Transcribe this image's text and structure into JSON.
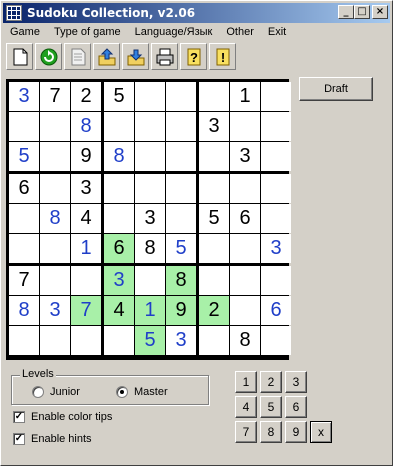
{
  "window": {
    "title": "Sudoku Collection, v2.06"
  },
  "menu": [
    "Game",
    "Type of game",
    "Language/Язык",
    "Other",
    "Exit"
  ],
  "toolbar": [
    "new-page-icon",
    "refresh-icon",
    "blank-document-icon",
    "upload-icon",
    "download-icon",
    "printer-icon",
    "question-mark-icon",
    "exclamation-icon"
  ],
  "draft_label": "Draft",
  "grid": [
    [
      {
        "v": "3",
        "k": "u"
      },
      {
        "v": "7",
        "k": "g"
      },
      {
        "v": "2",
        "k": "g"
      },
      {
        "v": "5",
        "k": "g"
      },
      {
        "v": "",
        "k": ""
      },
      {
        "v": "",
        "k": ""
      },
      {
        "v": "",
        "k": ""
      },
      {
        "v": "1",
        "k": "g"
      },
      {
        "v": "",
        "k": ""
      }
    ],
    [
      {
        "v": "",
        "k": ""
      },
      {
        "v": "",
        "k": ""
      },
      {
        "v": "8",
        "k": "u"
      },
      {
        "v": "",
        "k": ""
      },
      {
        "v": "",
        "k": ""
      },
      {
        "v": "",
        "k": ""
      },
      {
        "v": "3",
        "k": "g"
      },
      {
        "v": "",
        "k": ""
      },
      {
        "v": "",
        "k": ""
      }
    ],
    [
      {
        "v": "5",
        "k": "u"
      },
      {
        "v": "",
        "k": ""
      },
      {
        "v": "9",
        "k": "g"
      },
      {
        "v": "8",
        "k": "u"
      },
      {
        "v": "",
        "k": ""
      },
      {
        "v": "",
        "k": ""
      },
      {
        "v": "",
        "k": ""
      },
      {
        "v": "3",
        "k": "g"
      },
      {
        "v": "",
        "k": ""
      }
    ],
    [
      {
        "v": "6",
        "k": "g"
      },
      {
        "v": "",
        "k": ""
      },
      {
        "v": "3",
        "k": "g"
      },
      {
        "v": "",
        "k": ""
      },
      {
        "v": "",
        "k": ""
      },
      {
        "v": "",
        "k": ""
      },
      {
        "v": "",
        "k": ""
      },
      {
        "v": "",
        "k": ""
      },
      {
        "v": "",
        "k": ""
      }
    ],
    [
      {
        "v": "",
        "k": ""
      },
      {
        "v": "8",
        "k": "u"
      },
      {
        "v": "4",
        "k": "g"
      },
      {
        "v": "",
        "k": ""
      },
      {
        "v": "3",
        "k": "g"
      },
      {
        "v": "",
        "k": ""
      },
      {
        "v": "5",
        "k": "g"
      },
      {
        "v": "6",
        "k": "g"
      },
      {
        "v": "",
        "k": ""
      }
    ],
    [
      {
        "v": "",
        "k": ""
      },
      {
        "v": "",
        "k": ""
      },
      {
        "v": "1",
        "k": "u"
      },
      {
        "v": "6",
        "k": "g",
        "h": 1
      },
      {
        "v": "8",
        "k": "g"
      },
      {
        "v": "5",
        "k": "u"
      },
      {
        "v": "",
        "k": ""
      },
      {
        "v": "",
        "k": ""
      },
      {
        "v": "3",
        "k": "u"
      }
    ],
    [
      {
        "v": "7",
        "k": "g"
      },
      {
        "v": "",
        "k": ""
      },
      {
        "v": "",
        "k": ""
      },
      {
        "v": "3",
        "k": "u",
        "h": 1
      },
      {
        "v": "",
        "k": ""
      },
      {
        "v": "8",
        "k": "g",
        "h": 1
      },
      {
        "v": "",
        "k": ""
      },
      {
        "v": "",
        "k": ""
      },
      {
        "v": "",
        "k": ""
      }
    ],
    [
      {
        "v": "8",
        "k": "u"
      },
      {
        "v": "3",
        "k": "u"
      },
      {
        "v": "7",
        "k": "u",
        "h": 1
      },
      {
        "v": "4",
        "k": "g",
        "h": 1
      },
      {
        "v": "1",
        "k": "u",
        "h": 1
      },
      {
        "v": "9",
        "k": "g",
        "h": 1
      },
      {
        "v": "2",
        "k": "g",
        "h": 1
      },
      {
        "v": "",
        "k": ""
      },
      {
        "v": "6",
        "k": "u"
      }
    ],
    [
      {
        "v": "",
        "k": ""
      },
      {
        "v": "",
        "k": ""
      },
      {
        "v": "",
        "k": ""
      },
      {
        "v": "",
        "k": ""
      },
      {
        "v": "5",
        "k": "u",
        "h": 1
      },
      {
        "v": "3",
        "k": "u"
      },
      {
        "v": "",
        "k": ""
      },
      {
        "v": "8",
        "k": "g"
      },
      {
        "v": "",
        "k": ""
      }
    ]
  ],
  "levels": {
    "legend": "Levels",
    "junior": "Junior",
    "master": "Master",
    "selected": "master"
  },
  "options": {
    "color_tips": "Enable color tips",
    "color_tips_checked": true,
    "hints": "Enable hints",
    "hints_checked": true
  },
  "numpad": [
    "1",
    "2",
    "3",
    "4",
    "5",
    "6",
    "7",
    "8",
    "9",
    "x"
  ],
  "colors": {
    "user_digit": "#1f3ec8",
    "highlight": "#a8f0a8",
    "title_bar": "#0a246a"
  }
}
